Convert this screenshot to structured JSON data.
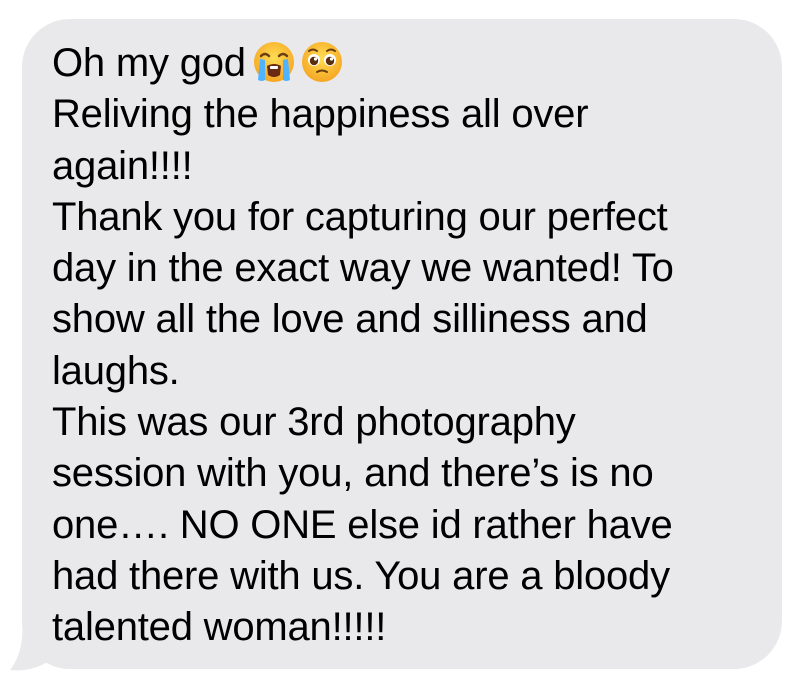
{
  "message_bubble": {
    "background_color": "#e9e9eb",
    "text_color": "#000000",
    "lines": [
      {
        "text": "Oh my god",
        "emojis": [
          "loudly-crying-face-icon",
          "pleading-face-icon"
        ]
      },
      {
        "text": "Reliving the happiness all over"
      },
      {
        "text": "again!!!!"
      },
      {
        "text": "Thank you for capturing our perfect"
      },
      {
        "text": "day in the exact way we wanted! To"
      },
      {
        "text": "show all the love and silliness and"
      },
      {
        "text": "laughs."
      },
      {
        "text": "This was our 3rd photography"
      },
      {
        "text": "session with you, and there’s is no"
      },
      {
        "text": "one…. NO ONE else id rather have"
      },
      {
        "text": "had there with us. You are a bloody"
      },
      {
        "text": "talented woman!!!!!"
      }
    ]
  }
}
